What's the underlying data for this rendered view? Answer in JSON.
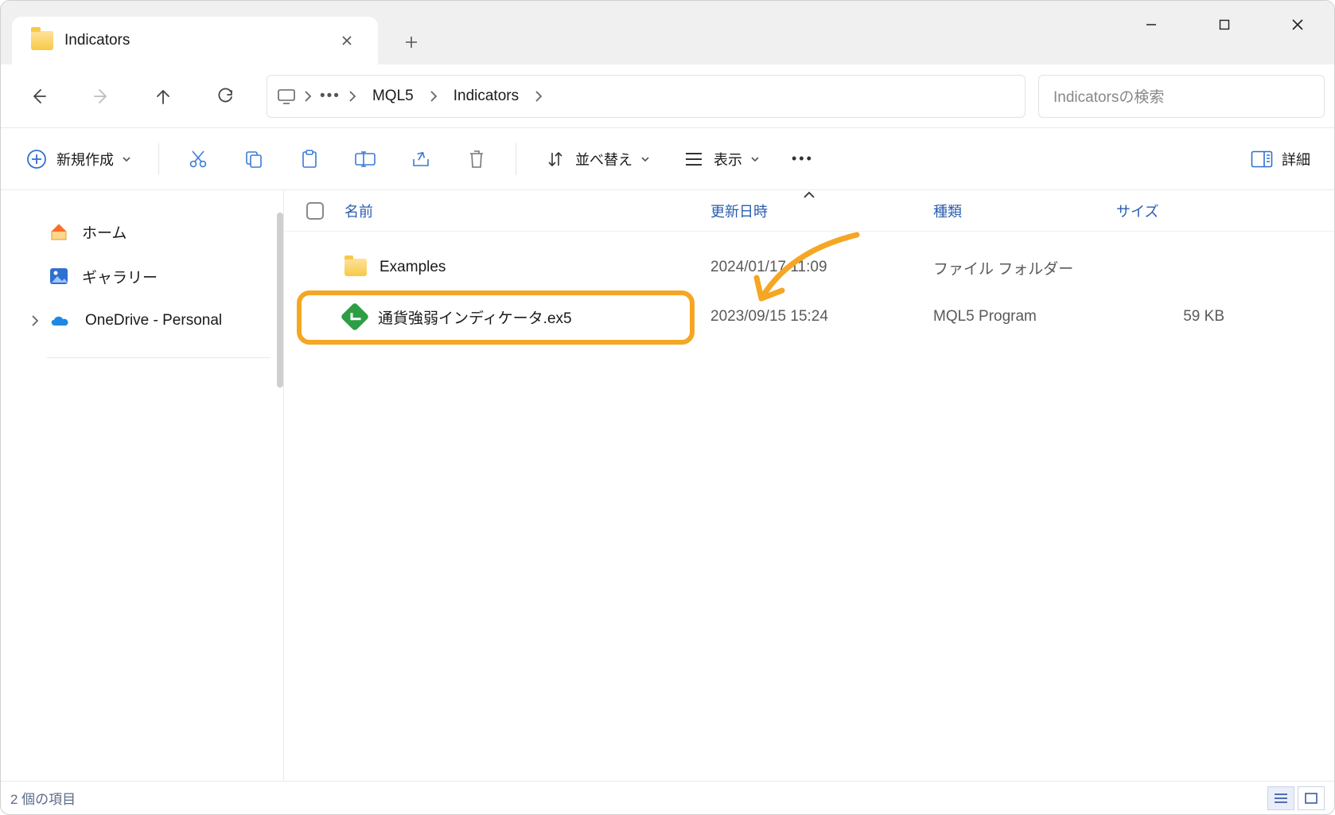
{
  "tab": {
    "title": "Indicators"
  },
  "breadcrumb": {
    "levels": [
      "MQL5",
      "Indicators"
    ]
  },
  "search": {
    "placeholder": "Indicatorsの検索"
  },
  "toolbar": {
    "new_label": "新規作成",
    "sort_label": "並べ替え",
    "view_label": "表示",
    "details_label": "詳細"
  },
  "sidebar": {
    "items": [
      {
        "label": "ホーム",
        "icon": "home"
      },
      {
        "label": "ギャラリー",
        "icon": "gallery"
      },
      {
        "label": "OneDrive - Personal",
        "icon": "onedrive",
        "expandable": true
      }
    ]
  },
  "columns": {
    "name": "名前",
    "date": "更新日時",
    "type": "種類",
    "size": "サイズ"
  },
  "rows": [
    {
      "name": "Examples",
      "date": "2024/01/17 11:09",
      "type": "ファイル フォルダー",
      "size": "",
      "icon": "folder"
    },
    {
      "name": "通貨強弱インディケータ.ex5",
      "date": "2023/09/15 15:24",
      "type": "MQL5 Program",
      "size": "59 KB",
      "icon": "ex5"
    }
  ],
  "status": {
    "text": "2 個の項目"
  },
  "annotation": {
    "highlight_row_index": 1
  }
}
